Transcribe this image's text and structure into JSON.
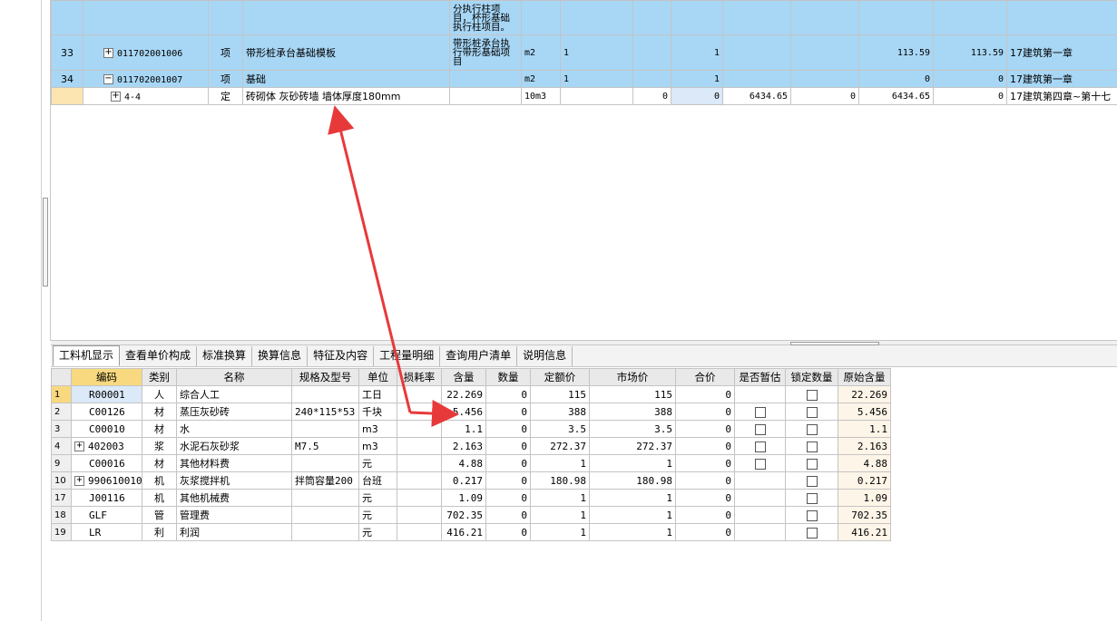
{
  "top_grid": {
    "rows": [
      {
        "rownum": "",
        "toggle": "",
        "code": "",
        "type": "",
        "name": "",
        "feature": "分执行柱项目，杯形基础执行柱项目。",
        "unit": "",
        "expr": "",
        "c7": "",
        "c8": "",
        "c9": "",
        "c10": "",
        "c11": "",
        "c12": "",
        "c13": "",
        "c14": ""
      },
      {
        "rownum": "33",
        "toggle": "+",
        "code": "011702001006",
        "type": "项",
        "name": "带形桩承台基础模板",
        "feature": "带形桩承台执行带形基础项目",
        "unit": "m2",
        "expr": "1",
        "c7": "",
        "c8": "1",
        "c9": "",
        "c10": "",
        "c11": "113.59",
        "c12": "113.59",
        "c13": "17建筑第一章",
        "c14": ""
      },
      {
        "rownum": "34",
        "toggle": "−",
        "code": "011702001007",
        "type": "项",
        "name": "基础",
        "feature": "",
        "unit": "m2",
        "expr": "1",
        "c7": "",
        "c8": "1",
        "c9": "",
        "c10": "",
        "c11": "0",
        "c12": "0",
        "c13": "17建筑第一章",
        "c14": ""
      },
      {
        "rownum": "",
        "toggle": "+",
        "code": "4-4",
        "type": "定",
        "name": "砖砌体 灰砂砖墙 墙体厚度180mm",
        "feature": "",
        "unit": "10m3",
        "expr": "",
        "c7": "0",
        "c8": "0",
        "c9": "6434.65",
        "c10": "0",
        "c11": "6434.65",
        "c12": "0",
        "c13": "17建筑第四章~第十七",
        "c14": ""
      }
    ]
  },
  "tabs": [
    "工料机显示",
    "查看单价构成",
    "标准换算",
    "换算信息",
    "特征及内容",
    "工程量明细",
    "查询用户清单",
    "说明信息"
  ],
  "bottom_grid": {
    "headers": [
      "",
      "编码",
      "类别",
      "名称",
      "规格及型号",
      "单位",
      "损耗率",
      "含量",
      "数量",
      "定额价",
      "市场价",
      "合价",
      "是否暂估",
      "锁定数量",
      "原始含量"
    ],
    "rows": [
      {
        "rownum": "1",
        "toggle": "",
        "code": "R00001",
        "cat": "人",
        "name": "综合人工",
        "spec": "",
        "unit": "工日",
        "loss": "",
        "qty_content": "22.269",
        "qty": "0",
        "quota_price": "115",
        "market_price": "115",
        "total": "0",
        "est_box": false,
        "lock_box": true,
        "orig": "22.269"
      },
      {
        "rownum": "2",
        "toggle": "",
        "code": "C00126",
        "cat": "材",
        "name": "蒸压灰砂砖",
        "spec": "240*115*53",
        "unit": "千块",
        "loss": "",
        "qty_content": "5.456",
        "qty": "0",
        "quota_price": "388",
        "market_price": "388",
        "total": "0",
        "est_box": true,
        "lock_box": true,
        "orig": "5.456"
      },
      {
        "rownum": "3",
        "toggle": "",
        "code": "C00010",
        "cat": "材",
        "name": "水",
        "spec": "",
        "unit": "m3",
        "loss": "",
        "qty_content": "1.1",
        "qty": "0",
        "quota_price": "3.5",
        "market_price": "3.5",
        "total": "0",
        "est_box": true,
        "lock_box": true,
        "orig": "1.1"
      },
      {
        "rownum": "4",
        "toggle": "+",
        "code": "402003",
        "cat": "浆",
        "name": "水泥石灰砂浆",
        "spec": "M7.5",
        "unit": "m3",
        "loss": "",
        "qty_content": "2.163",
        "qty": "0",
        "quota_price": "272.37",
        "market_price": "272.37",
        "total": "0",
        "est_box": true,
        "lock_box": true,
        "orig": "2.163"
      },
      {
        "rownum": "9",
        "toggle": "",
        "code": "C00016",
        "cat": "材",
        "name": "其他材料费",
        "spec": "",
        "unit": "元",
        "loss": "",
        "qty_content": "4.88",
        "qty": "0",
        "quota_price": "1",
        "market_price": "1",
        "total": "0",
        "est_box": true,
        "lock_box": true,
        "orig": "4.88"
      },
      {
        "rownum": "10",
        "toggle": "+",
        "code": "990610010",
        "cat": "机",
        "name": "灰浆搅拌机",
        "spec": "拌筒容量200",
        "unit": "台班",
        "loss": "",
        "qty_content": "0.217",
        "qty": "0",
        "quota_price": "180.98",
        "market_price": "180.98",
        "total": "0",
        "est_box": false,
        "lock_box": true,
        "orig": "0.217"
      },
      {
        "rownum": "17",
        "toggle": "",
        "code": "J00116",
        "cat": "机",
        "name": "其他机械费",
        "spec": "",
        "unit": "元",
        "loss": "",
        "qty_content": "1.09",
        "qty": "0",
        "quota_price": "1",
        "market_price": "1",
        "total": "0",
        "est_box": false,
        "lock_box": true,
        "orig": "1.09"
      },
      {
        "rownum": "18",
        "toggle": "",
        "code": "GLF",
        "cat": "管",
        "name": "管理费",
        "spec": "",
        "unit": "元",
        "loss": "",
        "qty_content": "702.35",
        "qty": "0",
        "quota_price": "1",
        "market_price": "1",
        "total": "0",
        "est_box": false,
        "lock_box": true,
        "orig": "702.35"
      },
      {
        "rownum": "19",
        "toggle": "",
        "code": "LR",
        "cat": "利",
        "name": "利润",
        "spec": "",
        "unit": "元",
        "loss": "",
        "qty_content": "416.21",
        "qty": "0",
        "quota_price": "1",
        "market_price": "1",
        "total": "0",
        "est_box": false,
        "lock_box": true,
        "orig": "416.21"
      }
    ]
  },
  "colors": {
    "row_blue": "#a8d7f6",
    "header_active": "#f9d980",
    "arrow": "#e8393a"
  }
}
